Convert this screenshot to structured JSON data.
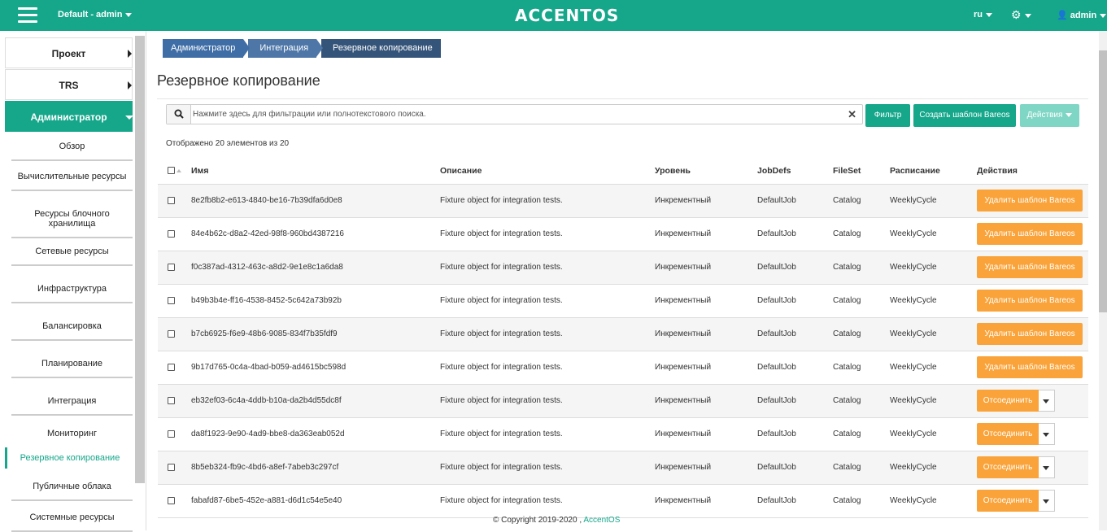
{
  "topbar": {
    "project": "Default - admin",
    "logo": "ACCENTOS",
    "lang": "ru",
    "user": "admin",
    "accent_color": "#16a78b"
  },
  "sidebar": {
    "sections": [
      {
        "label": "Проект"
      },
      {
        "label": "TRS"
      },
      {
        "label": "Администратор"
      }
    ],
    "items": [
      {
        "label": "Обзор"
      },
      {
        "label": "Вычислительные ресурсы"
      },
      {
        "label": "Ресурсы блочного хранилища"
      },
      {
        "label": "Сетевые ресурсы"
      },
      {
        "label": "Инфраструктура"
      },
      {
        "label": "Балансировка"
      },
      {
        "label": "Планирование"
      },
      {
        "label": "Интеграция"
      },
      {
        "label": "Мониторинг"
      },
      {
        "label": "Резервное копирование"
      },
      {
        "label": "Публичные облака"
      },
      {
        "label": "Системные ресурсы"
      }
    ]
  },
  "breadcrumb": [
    "Администратор",
    "Интеграция",
    "Резервное копирование"
  ],
  "page_title": "Резервное копирование",
  "search": {
    "placeholder": "Нажмите здесь для фильтрации или полнотекстового поиска."
  },
  "toolbar": {
    "filter_label": "Фильтр",
    "create_label": "Создать шаблон Bareos",
    "actions_label": "Действия"
  },
  "count_text": "Отображено 20 элементов из 20",
  "table": {
    "headers": [
      "Имя",
      "Описание",
      "Уровень",
      "JobDefs",
      "FileSet",
      "Расписание",
      "Действия"
    ],
    "rows": [
      {
        "name": "8e2fb8b2-e613-4840-be16-7b39dfa6d0e8",
        "desc": "Fixture object for integration tests.",
        "level": "Инкрементный",
        "jobdefs": "DefaultJob",
        "fileset": "Catalog",
        "schedule": "WeeklyCycle",
        "action": "Удалить шаблон Bareos",
        "action_type": "delete"
      },
      {
        "name": "84e4b62c-d8a2-42ed-98f8-960bd4387216",
        "desc": "Fixture object for integration tests.",
        "level": "Инкрементный",
        "jobdefs": "DefaultJob",
        "fileset": "Catalog",
        "schedule": "WeeklyCycle",
        "action": "Удалить шаблон Bareos",
        "action_type": "delete"
      },
      {
        "name": "f0c387ad-4312-463c-a8d2-9e1e8c1a6da8",
        "desc": "Fixture object for integration tests.",
        "level": "Инкрементный",
        "jobdefs": "DefaultJob",
        "fileset": "Catalog",
        "schedule": "WeeklyCycle",
        "action": "Удалить шаблон Bareos",
        "action_type": "delete"
      },
      {
        "name": "b49b3b4e-ff16-4538-8452-5c642a73b92b",
        "desc": "Fixture object for integration tests.",
        "level": "Инкрементный",
        "jobdefs": "DefaultJob",
        "fileset": "Catalog",
        "schedule": "WeeklyCycle",
        "action": "Удалить шаблон Bareos",
        "action_type": "delete"
      },
      {
        "name": "b7cb6925-f6e9-48b6-9085-834f7b35fdf9",
        "desc": "Fixture object for integration tests.",
        "level": "Инкрементный",
        "jobdefs": "DefaultJob",
        "fileset": "Catalog",
        "schedule": "WeeklyCycle",
        "action": "Удалить шаблон Bareos",
        "action_type": "delete"
      },
      {
        "name": "9b17d765-0c4a-4bad-b059-ad4615bc598d",
        "desc": "Fixture object for integration tests.",
        "level": "Инкрементный",
        "jobdefs": "DefaultJob",
        "fileset": "Catalog",
        "schedule": "WeeklyCycle",
        "action": "Удалить шаблон Bareos",
        "action_type": "delete"
      },
      {
        "name": "eb32ef03-6c4a-4ddb-b10a-da2b4d55dc8f",
        "desc": "Fixture object for integration tests.",
        "level": "Инкрементный",
        "jobdefs": "DefaultJob",
        "fileset": "Catalog",
        "schedule": "WeeklyCycle",
        "action": "Отсоединить",
        "action_type": "detach"
      },
      {
        "name": "da8f1923-9e90-4ad9-bbe8-da363eab052d",
        "desc": "Fixture object for integration tests.",
        "level": "Инкрементный",
        "jobdefs": "DefaultJob",
        "fileset": "Catalog",
        "schedule": "WeeklyCycle",
        "action": "Отсоединить",
        "action_type": "detach"
      },
      {
        "name": "8b5eb324-fb9c-4bd6-a8ef-7abeb3c297cf",
        "desc": "Fixture object for integration tests.",
        "level": "Инкрементный",
        "jobdefs": "DefaultJob",
        "fileset": "Catalog",
        "schedule": "WeeklyCycle",
        "action": "Отсоединить",
        "action_type": "detach"
      },
      {
        "name": "fabafd87-6be5-452e-a881-d6d1c54e5e40",
        "desc": "Fixture object for integration tests.",
        "level": "Инкрементный",
        "jobdefs": "DefaultJob",
        "fileset": "Catalog",
        "schedule": "WeeklyCycle",
        "action": "Отсоединить",
        "action_type": "detach"
      }
    ]
  },
  "footer": {
    "copyright": "© Copyright 2019-2020 ,",
    "link": "AccentOS"
  }
}
